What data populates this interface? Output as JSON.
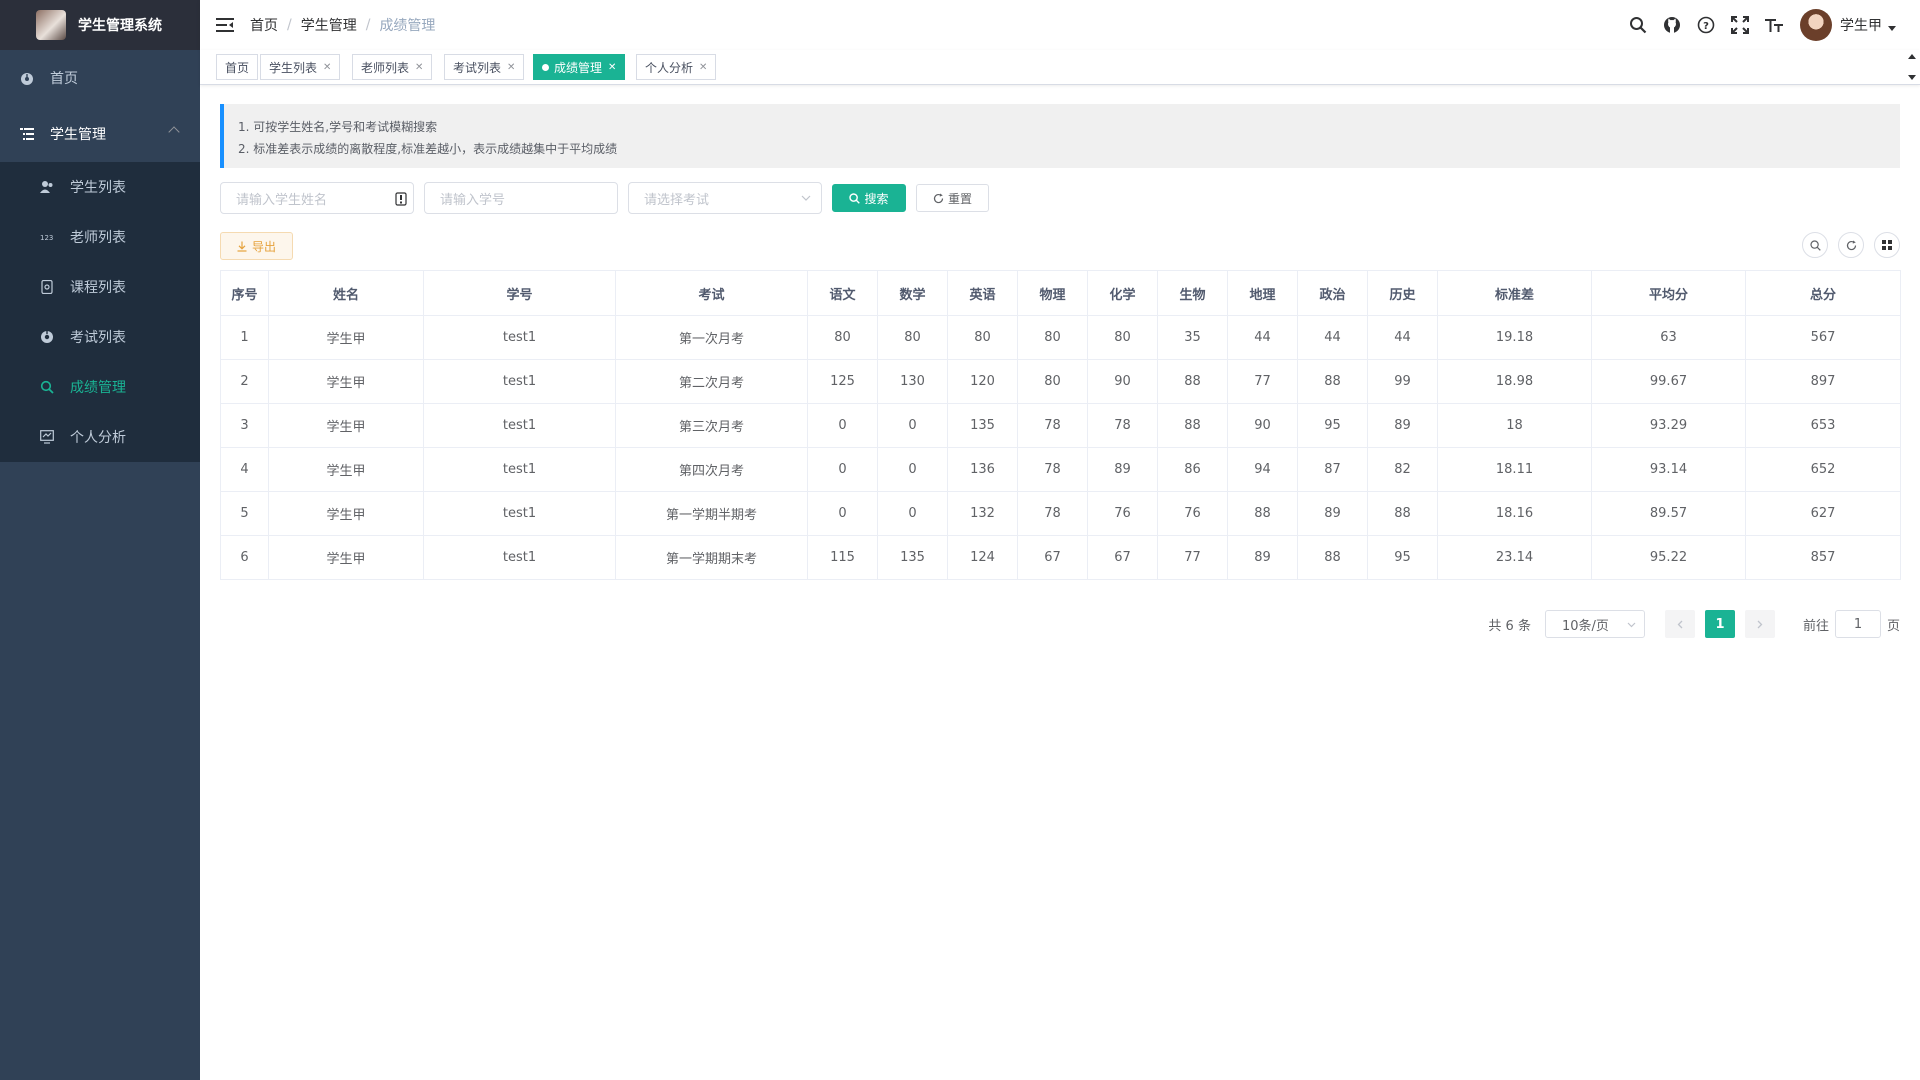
{
  "app": {
    "title": "学生管理系统"
  },
  "sidebar": {
    "home": "首页",
    "group": "学生管理",
    "items": [
      {
        "label": "学生列表"
      },
      {
        "label": "老师列表"
      },
      {
        "label": "课程列表"
      },
      {
        "label": "考试列表"
      },
      {
        "label": "成绩管理"
      },
      {
        "label": "个人分析"
      }
    ]
  },
  "breadcrumb": {
    "home": "首页",
    "parent": "学生管理",
    "current": "成绩管理"
  },
  "user": {
    "name": "学生甲"
  },
  "tags": [
    {
      "label": "首页"
    },
    {
      "label": "学生列表"
    },
    {
      "label": "老师列表"
    },
    {
      "label": "考试列表"
    },
    {
      "label": "成绩管理"
    },
    {
      "label": "个人分析"
    }
  ],
  "tips": {
    "line1": "1. 可按学生姓名,学号和考试模糊搜索",
    "line2": "2. 标准差表示成绩的离散程度,标准差越小，表示成绩越集中于平均成绩"
  },
  "search": {
    "name_placeholder": "请输入学生姓名",
    "id_placeholder": "请输入学号",
    "exam_placeholder": "请选择考试",
    "search_label": "搜索",
    "reset_label": "重置"
  },
  "toolbar": {
    "export_label": "导出"
  },
  "table": {
    "headers": [
      "序号",
      "姓名",
      "学号",
      "考试",
      "语文",
      "数学",
      "英语",
      "物理",
      "化学",
      "生物",
      "地理",
      "政治",
      "历史",
      "标准差",
      "平均分",
      "总分"
    ],
    "rows": [
      [
        "1",
        "学生甲",
        "test1",
        "第一次月考",
        "80",
        "80",
        "80",
        "80",
        "80",
        "35",
        "44",
        "44",
        "44",
        "19.18",
        "63",
        "567"
      ],
      [
        "2",
        "学生甲",
        "test1",
        "第二次月考",
        "125",
        "130",
        "120",
        "80",
        "90",
        "88",
        "77",
        "88",
        "99",
        "18.98",
        "99.67",
        "897"
      ],
      [
        "3",
        "学生甲",
        "test1",
        "第三次月考",
        "0",
        "0",
        "135",
        "78",
        "78",
        "88",
        "90",
        "95",
        "89",
        "18",
        "93.29",
        "653"
      ],
      [
        "4",
        "学生甲",
        "test1",
        "第四次月考",
        "0",
        "0",
        "136",
        "78",
        "89",
        "86",
        "94",
        "87",
        "82",
        "18.11",
        "93.14",
        "652"
      ],
      [
        "5",
        "学生甲",
        "test1",
        "第一学期半期考",
        "0",
        "0",
        "132",
        "78",
        "76",
        "76",
        "88",
        "89",
        "88",
        "18.16",
        "89.57",
        "627"
      ],
      [
        "6",
        "学生甲",
        "test1",
        "第一学期期末考",
        "115",
        "135",
        "124",
        "67",
        "67",
        "77",
        "89",
        "88",
        "95",
        "23.14",
        "95.22",
        "857"
      ]
    ]
  },
  "pagination": {
    "total": "共 6 条",
    "page_size": "10条/页",
    "current": "1",
    "goto_prefix": "前往",
    "goto_value": "1",
    "goto_suffix": "页"
  },
  "colors": {
    "accent": "#1ab394",
    "sidebar_bg": "#304156",
    "warning": "#e6a23c",
    "info_bar": "#1890ff"
  }
}
